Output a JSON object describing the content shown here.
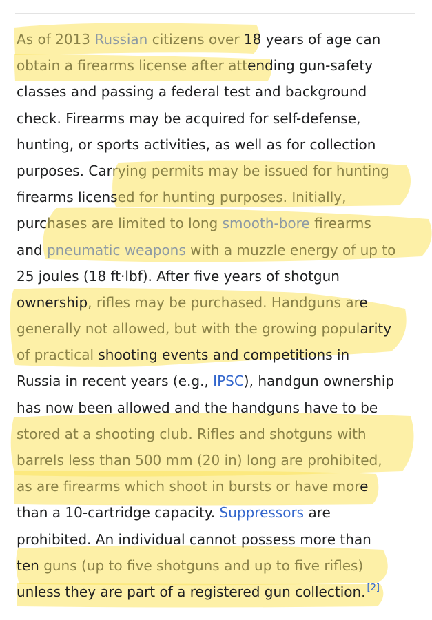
{
  "article": {
    "lines": [
      [
        {
          "t": "As of 2013 ",
          "hl": true
        },
        {
          "t": "Russian",
          "link": true,
          "hl": true
        },
        {
          "t": " citizens over ",
          "hl": true
        },
        {
          "t": "18 years of age can"
        }
      ],
      [
        {
          "t": "obtain a firearms license after att",
          "hl": true
        },
        {
          "t": "ending gun-safety"
        }
      ],
      [
        {
          "t": "classes and passing a federal test and background"
        }
      ],
      [
        {
          "t": "check. Firearms may be acquired for self-defense,"
        }
      ],
      [
        {
          "t": "hunting, or sports activities, as well as for collection"
        }
      ],
      [
        {
          "t": "purposes. Car"
        },
        {
          "t": "rying permits may be issued for hunting",
          "hl": true
        }
      ],
      [
        {
          "t": "firearms licens"
        },
        {
          "t": "ed for hunting purposes. Initially,",
          "hl": true
        }
      ],
      [
        {
          "t": "purc"
        },
        {
          "t": "hases are limited to long ",
          "hl": true
        },
        {
          "t": "smooth-bore",
          "link": true,
          "hl": true
        },
        {
          "t": " firearms",
          "hl": true
        }
      ],
      [
        {
          "t": "and "
        },
        {
          "t": "pneumatic weapons",
          "link": true,
          "hl": true
        },
        {
          "t": " with a muzzle energy of up to",
          "hl": true
        }
      ],
      [
        {
          "t": "25 joules (18 ft·lbf). After five years of shotgun"
        }
      ],
      [
        {
          "t": "ownership"
        },
        {
          "t": ", rifles may be purchased. Handguns ar",
          "hl": true
        },
        {
          "t": "e"
        }
      ],
      [
        {
          "t": "generally not allowed, but with the growing popul",
          "hl": true
        },
        {
          "t": "arity"
        }
      ],
      [
        {
          "t": "of practical",
          "hl": true
        },
        {
          "t": " shooting events and competitions in"
        }
      ],
      [
        {
          "t": "Russia in recent years (e.g., "
        },
        {
          "t": "IPSC",
          "link": true
        },
        {
          "t": "), handgun ownership"
        }
      ],
      [
        {
          "t": "has now been allowed and the handguns have to be"
        }
      ],
      [
        {
          "t": "stored at a shooting club. Rifles and shotguns with",
          "hl": true
        }
      ],
      [
        {
          "t": "barrels less than 500 mm (20 in) long are prohibited,",
          "hl": true
        }
      ],
      [
        {
          "t": "as are firearms which shoot in bursts or have mor",
          "hl": true
        },
        {
          "t": "e"
        }
      ],
      [
        {
          "t": "than a 10-cartridge capacity. "
        },
        {
          "t": "Suppressors",
          "link": true
        },
        {
          "t": " are"
        }
      ],
      [
        {
          "t": "prohibited. An individual cannot possess more than"
        }
      ],
      [
        {
          "t": "ten "
        },
        {
          "t": "guns (up to five shotguns and up to five rifles)",
          "hl": true
        }
      ],
      [
        {
          "t": "unless they are part of a registered gun collection."
        },
        {
          "t": "[2]",
          "link": true,
          "ref": true
        }
      ]
    ]
  },
  "colors": {
    "text": "#202122",
    "link": "#3366cc",
    "highlighted_text": "#8a8248",
    "highlighter": "#fbe35f"
  }
}
